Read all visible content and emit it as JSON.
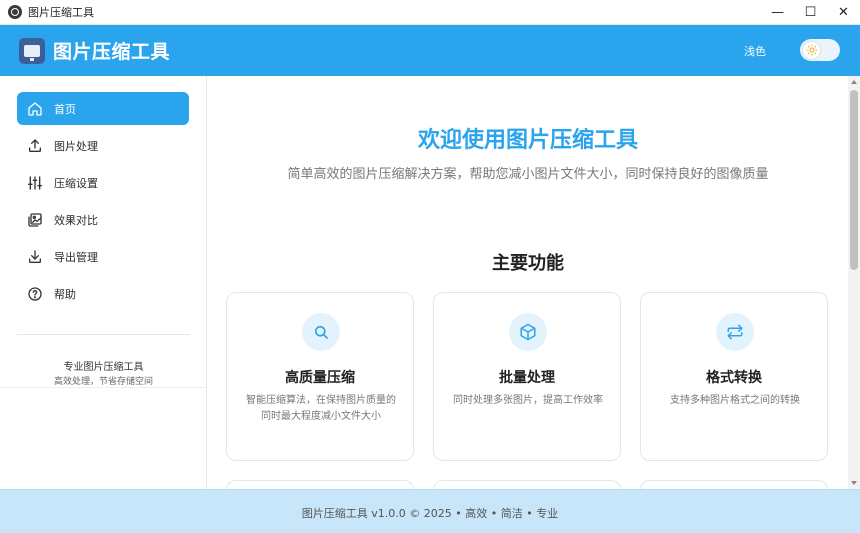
{
  "window": {
    "title": "图片压缩工具",
    "controls": {
      "minimize": "—",
      "maximize": "☐",
      "close": "✕"
    }
  },
  "header": {
    "app_title": "图片压缩工具",
    "theme_label": "浅色",
    "theme_icon": "sun-icon",
    "accent_color": "#2aa4ec"
  },
  "sidebar": {
    "items": [
      {
        "label": "首页",
        "icon": "home-icon",
        "active": true
      },
      {
        "label": "图片处理",
        "icon": "upload-icon",
        "active": false
      },
      {
        "label": "压缩设置",
        "icon": "sliders-icon",
        "active": false
      },
      {
        "label": "效果对比",
        "icon": "image-compare-icon",
        "active": false
      },
      {
        "label": "导出管理",
        "icon": "download-icon",
        "active": false
      },
      {
        "label": "帮助",
        "icon": "help-icon",
        "active": false
      }
    ],
    "footer_title": "专业图片压缩工具",
    "footer_subtitle": "高效处理，节省存储空间"
  },
  "main": {
    "welcome_title": "欢迎使用图片压缩工具",
    "welcome_subtitle": "简单高效的图片压缩解决方案，帮助您减小图片文件大小，同时保持良好的图像质量",
    "features_title": "主要功能",
    "features": [
      {
        "title": "高质量压缩",
        "description": "智能压缩算法，在保持图片质量的同时最大程度减小文件大小",
        "icon": "search-icon"
      },
      {
        "title": "批量处理",
        "description": "同时处理多张图片，提高工作效率",
        "icon": "box-icon"
      },
      {
        "title": "格式转换",
        "description": "支持多种图片格式之间的转换",
        "icon": "swap-icon"
      }
    ]
  },
  "footer": {
    "text": "图片压缩工具 v1.0.0 © 2025 • 高效 • 简洁 • 专业"
  }
}
